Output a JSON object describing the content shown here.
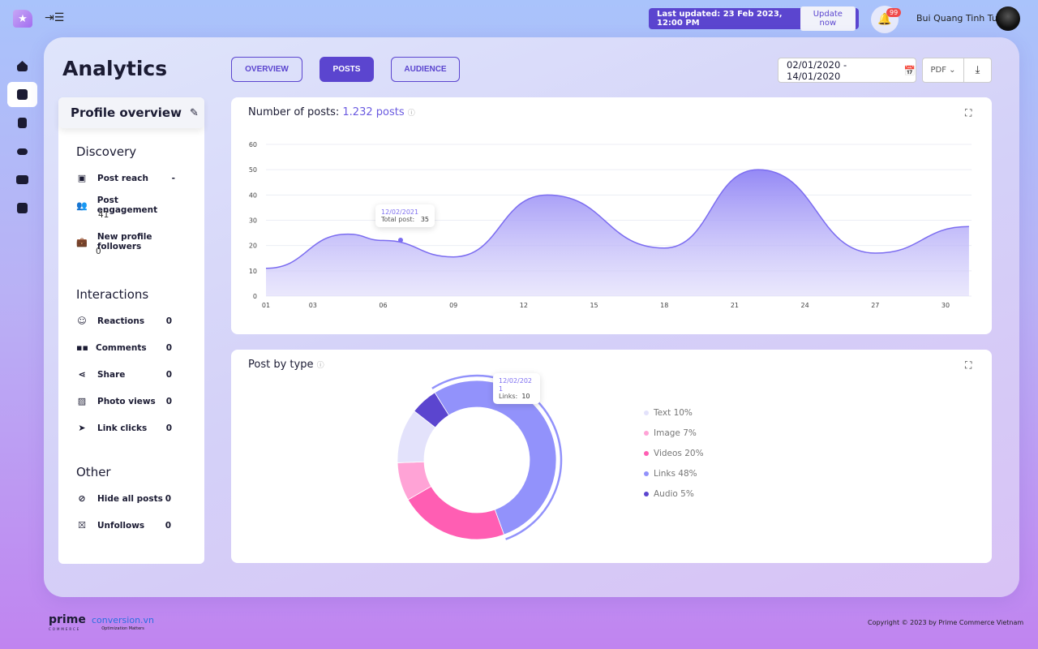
{
  "app": {
    "logo_icon": "star-icon",
    "menu_icon": "menu-collapse-icon"
  },
  "header": {
    "last_updated": "Last updated: 23 Feb 2023, 12:00 PM",
    "update_label": "Update now",
    "notif_count": "99",
    "user_name": "Bui Quang Tinh Tu"
  },
  "sidebar": {
    "items": [
      {
        "icon": "home-icon"
      },
      {
        "icon": "analytics-icon",
        "active": true
      },
      {
        "icon": "document-icon"
      },
      {
        "icon": "settings-sliders-icon"
      },
      {
        "icon": "grid-icon"
      },
      {
        "icon": "info-icon"
      }
    ]
  },
  "page": {
    "title": "Analytics",
    "tabs": [
      {
        "label": "OVERVIEW"
      },
      {
        "label": "POSTS",
        "active": true
      },
      {
        "label": "AUDIENCE"
      }
    ],
    "date_range": "02/01/2020 - 14/01/2020",
    "export_format": "PDF"
  },
  "profile": {
    "title": "Profile overview",
    "discovery": {
      "title": "Discovery",
      "items": [
        {
          "label": "Post reach",
          "value": "-"
        },
        {
          "label": "Post engagement",
          "value": "41"
        },
        {
          "label": "New profile followers",
          "value": "0"
        }
      ]
    },
    "interactions": {
      "title": "Interactions",
      "items": [
        {
          "label": "Reactions",
          "value": "0"
        },
        {
          "label": "Comments",
          "value": "0"
        },
        {
          "label": "Share",
          "value": "0"
        },
        {
          "label": "Photo views",
          "value": "0"
        },
        {
          "label": "Link clicks",
          "value": "0"
        }
      ]
    },
    "other": {
      "title": "Other",
      "items": [
        {
          "label": "Hide all posts",
          "value": "0"
        },
        {
          "label": "Unfollows",
          "value": "0"
        }
      ]
    }
  },
  "posts_card": {
    "title": "Number of posts: ",
    "count": "1.232 posts",
    "tooltip": {
      "date": "12/02/2021",
      "label": "Total post:",
      "value": "35"
    }
  },
  "type_card": {
    "title": "Post by type",
    "tooltip": {
      "date": "12/02/2021",
      "label": "Links:",
      "value": "10"
    }
  },
  "chart_data": [
    {
      "type": "area",
      "yticks": [
        "0",
        "10",
        "20",
        "30",
        "40",
        "50",
        "60"
      ],
      "xticks": [
        "01",
        "03",
        "06",
        "09",
        "12",
        "15",
        "18",
        "21",
        "24",
        "27",
        "30"
      ],
      "ylim": [
        0,
        60
      ],
      "grid": true,
      "color": "#7b6cf0",
      "x": [
        1,
        4.5,
        6,
        9,
        13,
        18,
        22,
        27,
        31
      ],
      "y": [
        11,
        24.5,
        22,
        15.5,
        40,
        19,
        50,
        17,
        27.5
      ]
    },
    {
      "type": "pie",
      "donut": true,
      "legend": "right",
      "slices": [
        {
          "name": "Links",
          "label": "Links 48%",
          "value": 48,
          "color": "#9292fb"
        },
        {
          "name": "Videos",
          "label": "Videos 20%",
          "value": 20,
          "color": "#ff5eb3"
        },
        {
          "name": "Image",
          "label": "Image 7%",
          "value": 7,
          "color": "#ffa3d6"
        },
        {
          "name": "Text",
          "label": "Text 10%",
          "value": 10,
          "color": "#e3e2fb"
        },
        {
          "name": "Audio",
          "label": "Audio 5%",
          "value": 5,
          "color": "#5b45cf"
        }
      ],
      "legend_order": [
        "Text",
        "Image",
        "Videos",
        "Links",
        "Audio"
      ]
    }
  ],
  "footer": {
    "brand1": "prime",
    "brand1_sub": "COMMERCE",
    "brand2": "conversion.vn",
    "brand2_sub": "Optimization Matters",
    "copyright": "Copyright © 2023 by Prime Commerce Vietnam"
  }
}
